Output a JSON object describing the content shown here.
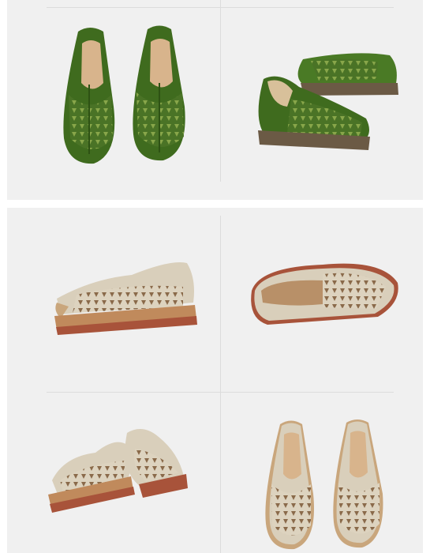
{
  "gallery": {
    "background": "#ffffff",
    "panel_color": "#f0f0f0",
    "rule_color": "#dcdcdc",
    "photos": [
      {
        "icon": "green-shoes-pair-top-view",
        "color": "#4f7a2c"
      },
      {
        "icon": "green-shoes-pair-side-view",
        "color": "#4f7a2c"
      },
      {
        "icon": "beige-shoe-side-view",
        "color": "#d9cfbb"
      },
      {
        "icon": "beige-shoe-top-angle-view",
        "color": "#d9cfbb"
      },
      {
        "icon": "beige-shoes-pair-angled-view",
        "color": "#d9cfbb"
      },
      {
        "icon": "beige-shoes-pair-top-view",
        "color": "#d9cfbb"
      }
    ]
  }
}
